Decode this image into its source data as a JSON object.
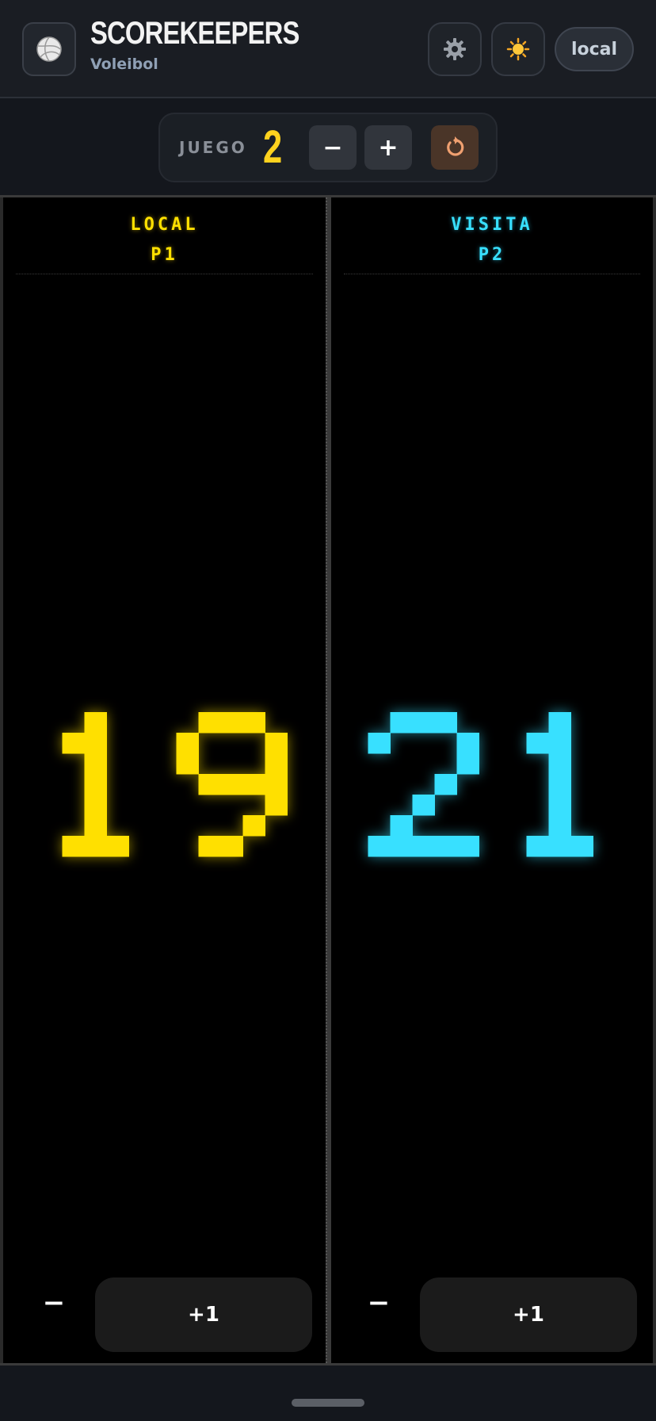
{
  "app": {
    "title": "SCOREKEEPERS",
    "subtitle": "Voleibol",
    "mode_label": "local",
    "icons": [
      "volleyball-icon",
      "gear-icon",
      "sun-icon",
      "reset-icon"
    ]
  },
  "game": {
    "label": "JUEGO",
    "number": "2",
    "decrement_label": "−",
    "increment_label": "+"
  },
  "teams": [
    {
      "name": "LOCAL",
      "player": "P1",
      "score": "19",
      "color": "#ffe000",
      "minus_label": "−",
      "plus_label": "+1"
    },
    {
      "name": "VISITA",
      "player": "P2",
      "score": "21",
      "color": "#38e0ff",
      "minus_label": "−",
      "plus_label": "+1"
    }
  ]
}
